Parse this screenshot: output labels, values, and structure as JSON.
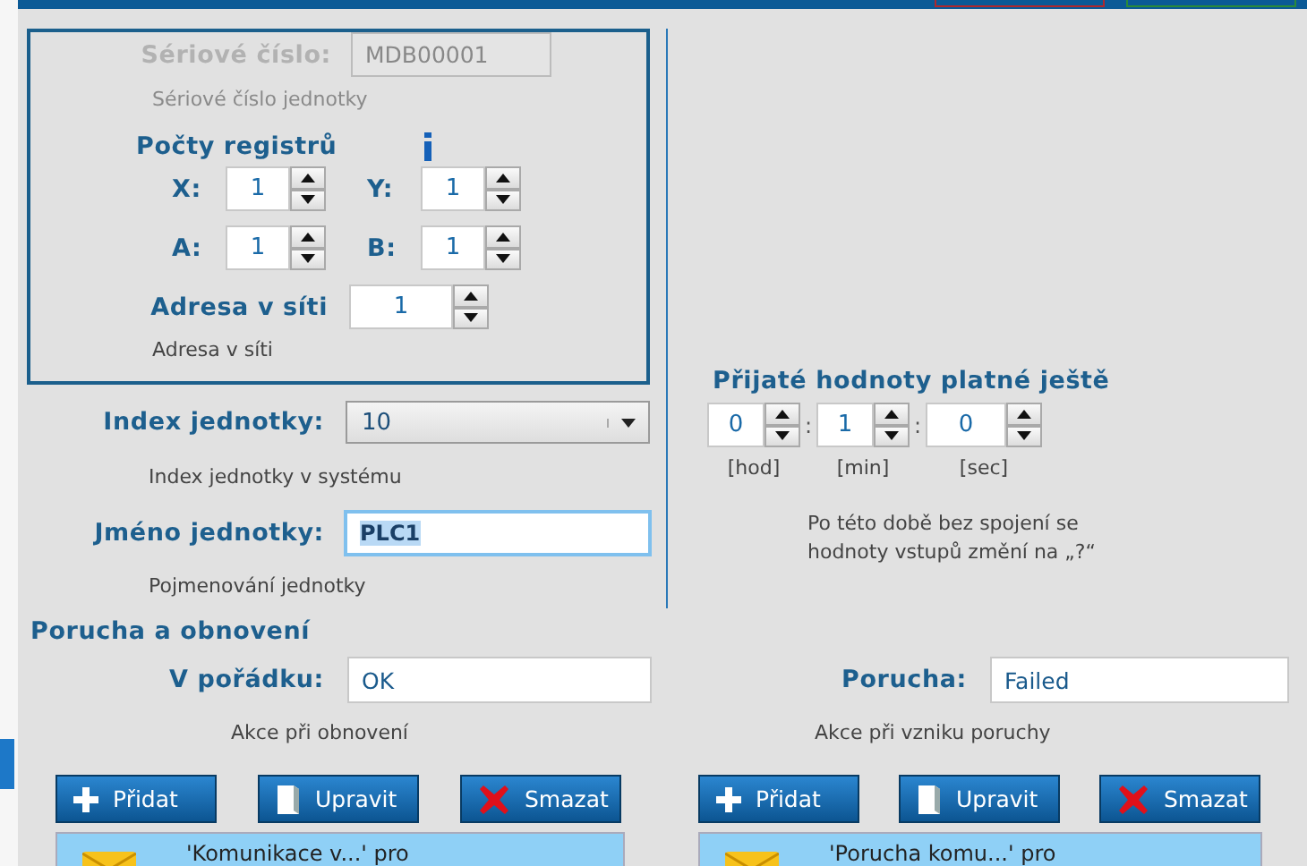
{
  "top_buttons": [
    {
      "color": "#b0282d"
    },
    {
      "color": "#2a8a3a"
    }
  ],
  "unit": {
    "serial": {
      "label": "Sériové číslo:",
      "value": "MDB00001",
      "disabled": true,
      "hint": "Sériové číslo jednotky"
    },
    "registers": {
      "title": "Počty registrů",
      "items": [
        {
          "label": "X:",
          "value": "1"
        },
        {
          "label": "Y:",
          "value": "1"
        },
        {
          "label": "A:",
          "value": "1"
        },
        {
          "label": "B:",
          "value": "1"
        }
      ]
    },
    "address": {
      "label": "Adresa v síti",
      "value": "1",
      "hint": "Adresa v síti"
    }
  },
  "index": {
    "label": "Index jednotky:",
    "value": "10",
    "hint": "Index jednotky v systému"
  },
  "name": {
    "label": "Jméno jednotky:",
    "value": "PLC1",
    "focused": true,
    "hint": "Pojmenování jednotky"
  },
  "validity": {
    "title": "Přijaté hodnoty platné ještě",
    "parts": [
      {
        "value": "0",
        "unit": "[hod]",
        "separator": ":"
      },
      {
        "value": "1",
        "unit": "[min]",
        "separator": ":"
      },
      {
        "value": "0",
        "unit": "[sec]"
      }
    ],
    "note": "Po této době bez spojení se hodnoty vstupů změní na „?“"
  },
  "fault": {
    "title": "Porucha a obnovení",
    "sides": [
      {
        "label": "V pořádku:",
        "value": "OK",
        "hint": "Akce při obnovení",
        "buttons": [
          {
            "kind": "add",
            "label": "Přidat"
          },
          {
            "kind": "edit",
            "label": "Upravit"
          },
          {
            "kind": "delete",
            "label": "Smazat"
          }
        ],
        "items": [
          {
            "text": "'Komunikace v...' pro"
          }
        ]
      },
      {
        "label": "Porucha:",
        "value": "Failed",
        "hint": "Akce při vzniku poruchy",
        "buttons": [
          {
            "kind": "add",
            "label": "Přidat"
          },
          {
            "kind": "edit",
            "label": "Upravit"
          },
          {
            "kind": "delete",
            "label": "Smazat"
          }
        ],
        "items": [
          {
            "text": "'Porucha komu...' pro"
          }
        ]
      }
    ]
  }
}
